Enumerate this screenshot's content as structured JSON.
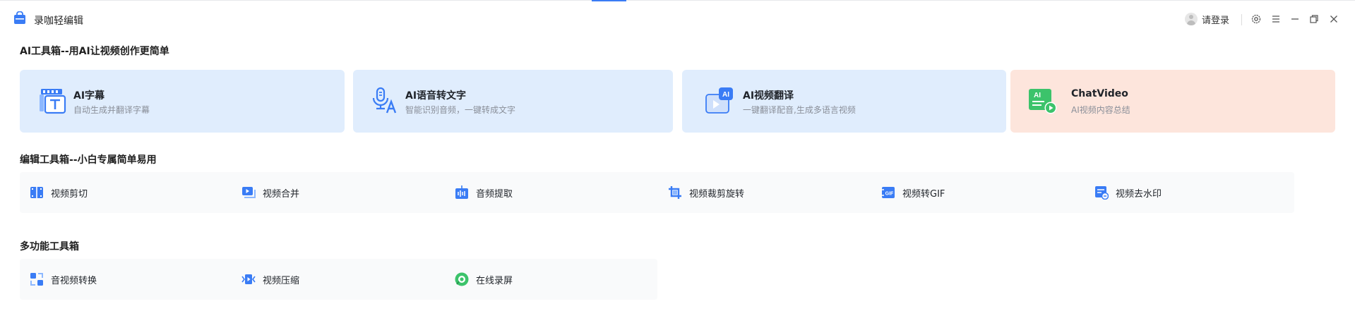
{
  "app": {
    "name": "录咖轻编辑"
  },
  "header": {
    "login_label": "请登录"
  },
  "window_controls": [
    "settings-icon",
    "menu-icon",
    "minimize-icon",
    "restore-icon",
    "close-icon"
  ],
  "sections": {
    "ai": "AI工具箱--用AI让视频创作更简单",
    "edit": "编辑工具箱--小白专属简单易用",
    "multi": "多功能工具箱"
  },
  "ai_tools": [
    {
      "title": "AI字幕",
      "desc": "自动生成并翻译字幕",
      "icon": "subtitle-icon"
    },
    {
      "title": "AI语音转文字",
      "desc": "智能识别音频，一键转成文字",
      "icon": "speech-to-text-icon"
    },
    {
      "title": "AI视频翻译",
      "desc": "一键翻译配音,生成多语言视频",
      "icon": "video-translate-icon"
    },
    {
      "title": "ChatVideo",
      "desc": "AI视频内容总结",
      "icon": "chatvideo-icon"
    }
  ],
  "edit_tools": [
    {
      "label": "视频剪切",
      "icon": "video-cut-icon"
    },
    {
      "label": "视频合并",
      "icon": "video-merge-icon"
    },
    {
      "label": "音频提取",
      "icon": "audio-extract-icon"
    },
    {
      "label": "视频裁剪旋转",
      "icon": "crop-rotate-icon"
    },
    {
      "label": "视频转GIF",
      "icon": "gif-icon"
    },
    {
      "label": "视频去水印",
      "icon": "watermark-remove-icon"
    }
  ],
  "multi_tools": [
    {
      "label": "音视频转换",
      "icon": "convert-icon"
    },
    {
      "label": "视频压缩",
      "icon": "compress-icon"
    },
    {
      "label": "在线录屏",
      "icon": "screen-record-icon"
    }
  ],
  "colors": {
    "accent": "#3a7cf5",
    "card_blue": "#e0edfd",
    "card_orange": "#fde5dc",
    "chatvideo_green": "#3cc36b"
  }
}
